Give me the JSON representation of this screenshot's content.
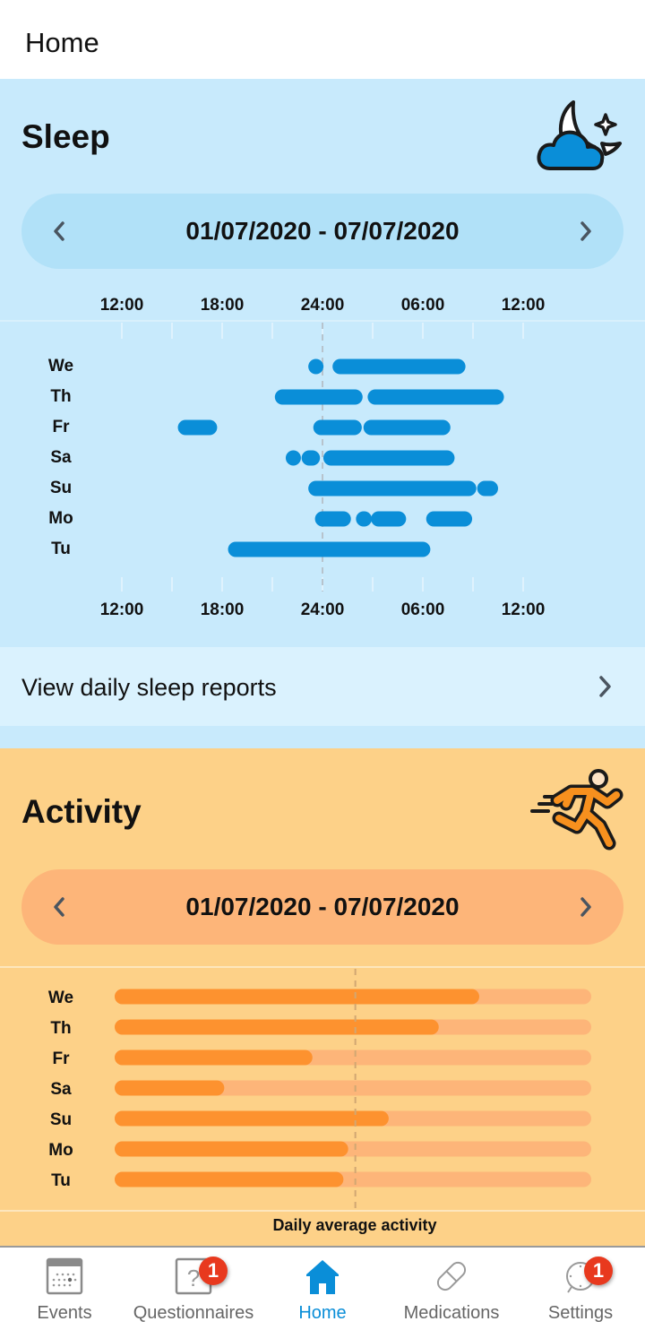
{
  "appbar": {
    "title": "Home"
  },
  "sleep": {
    "title": "Sleep",
    "icon": "moon-cloud-icon",
    "date_range": "01/07/2020 - 07/07/2020",
    "prev_icon": "chevron-left-icon",
    "next_icon": "chevron-right-icon",
    "report_link": "View daily sleep reports",
    "colors": {
      "bar": "#0a8ed8",
      "background": "#c8eafc"
    }
  },
  "activity": {
    "title": "Activity",
    "icon": "running-person-icon",
    "date_range": "01/07/2020 - 07/07/2020",
    "caption": "Daily average activity",
    "colors": {
      "fill": "#fd922f",
      "track": "#fdb579",
      "background": "#fdd188"
    }
  },
  "chart_data": [
    {
      "type": "timeline",
      "title": "Sleep",
      "x_ticks": [
        "12:00",
        "18:00",
        "24:00",
        "06:00",
        "12:00"
      ],
      "x_unit": "hours since 12:00 (noon)",
      "x_range": [
        0,
        24
      ],
      "reference_line": {
        "at": 12,
        "label": "24:00",
        "style": "dashed"
      },
      "categories": [
        "We",
        "Th",
        "Fr",
        "Sa",
        "Su",
        "Mo",
        "Tu"
      ],
      "series": [
        {
          "day": "We",
          "segments": [
            [
              "23:09",
              "00:03"
            ],
            [
              "00:35",
              "08:34"
            ]
          ],
          "hours": [
            [
              11.15,
              12.05
            ],
            [
              12.6,
              20.55
            ]
          ]
        },
        {
          "day": "Th",
          "segments": [
            [
              "21:10",
              "02:24"
            ],
            [
              "02:41",
              "10:52"
            ]
          ],
          "hours": [
            [
              9.15,
              14.4
            ],
            [
              14.7,
              22.85
            ]
          ]
        },
        {
          "day": "Fr",
          "segments": [
            [
              "15:22",
              "17:41"
            ],
            [
              "23:28",
              "02:21"
            ],
            [
              "02:28",
              "07:40"
            ]
          ],
          "hours": [
            [
              3.35,
              5.7
            ],
            [
              11.45,
              14.35
            ],
            [
              14.45,
              19.65
            ]
          ]
        },
        {
          "day": "Sa",
          "segments": [
            [
              "21:48",
              "22:43"
            ],
            [
              "22:46",
              "23:50"
            ],
            [
              "00:03",
              "07:52"
            ]
          ],
          "hours": [
            [
              9.8,
              10.7
            ],
            [
              10.75,
              11.85
            ],
            [
              12.05,
              19.9
            ]
          ]
        },
        {
          "day": "Su",
          "segments": [
            [
              "23:09",
              "09:10"
            ],
            [
              "09:13",
              "10:30"
            ]
          ],
          "hours": [
            [
              11.15,
              21.2
            ],
            [
              21.25,
              22.5
            ]
          ]
        },
        {
          "day": "Mo",
          "segments": [
            [
              "23:34",
              "01:43"
            ],
            [
              "02:02",
              "02:57"
            ],
            [
              "02:54",
              "04:59"
            ],
            [
              "06:10",
              "08:57"
            ]
          ],
          "hours": [
            [
              11.55,
              13.7
            ],
            [
              14.0,
              14.95
            ],
            [
              14.9,
              17.0
            ],
            [
              18.2,
              20.95
            ]
          ]
        },
        {
          "day": "Tu",
          "segments": [
            [
              "18:22",
              "06:26"
            ]
          ],
          "hours": [
            [
              6.35,
              18.45
            ]
          ]
        }
      ]
    },
    {
      "type": "bar",
      "orientation": "horizontal",
      "title": "Activity",
      "categories": [
        "We",
        "Th",
        "Fr",
        "Sa",
        "Su",
        "Mo",
        "Tu"
      ],
      "values": [
        0.765,
        0.68,
        0.415,
        0.23,
        0.575,
        0.49,
        0.48
      ],
      "value_unit": "fraction of daily goal",
      "reference_line": {
        "at": 0.505,
        "label": "Daily average activity",
        "style": "dashed"
      },
      "xlim": [
        0,
        1
      ]
    }
  ],
  "bottom_nav": [
    {
      "label": "Events",
      "icon": "calendar-icon",
      "badge": null,
      "active": false
    },
    {
      "label": "Questionnaires",
      "icon": "questionnaire-icon",
      "badge": "1",
      "active": false
    },
    {
      "label": "Home",
      "icon": "home-icon",
      "badge": null,
      "active": true
    },
    {
      "label": "Medications",
      "icon": "pill-icon",
      "badge": null,
      "active": false
    },
    {
      "label": "Settings",
      "icon": "settings-watch-icon",
      "badge": "1",
      "active": false
    }
  ]
}
